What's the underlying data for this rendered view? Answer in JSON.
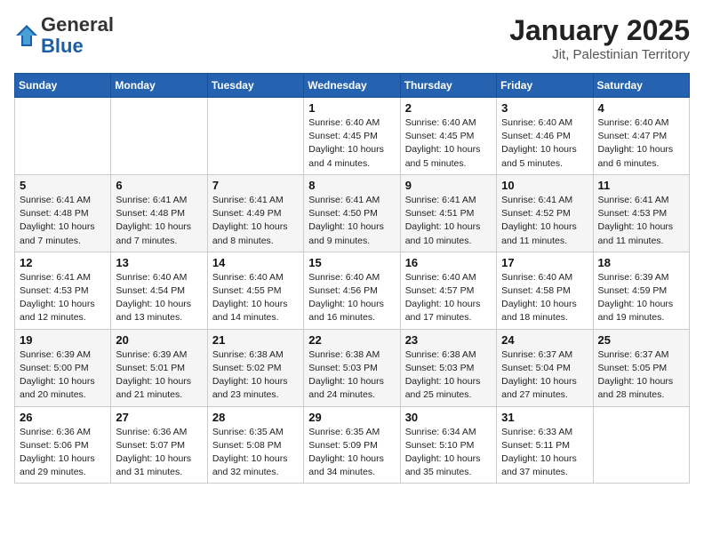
{
  "header": {
    "logo_line1": "General",
    "logo_line2": "Blue",
    "title": "January 2025",
    "subtitle": "Jit, Palestinian Territory"
  },
  "weekdays": [
    "Sunday",
    "Monday",
    "Tuesday",
    "Wednesday",
    "Thursday",
    "Friday",
    "Saturday"
  ],
  "weeks": [
    [
      {
        "day": "",
        "info": ""
      },
      {
        "day": "",
        "info": ""
      },
      {
        "day": "",
        "info": ""
      },
      {
        "day": "1",
        "info": "Sunrise: 6:40 AM\nSunset: 4:45 PM\nDaylight: 10 hours\nand 4 minutes."
      },
      {
        "day": "2",
        "info": "Sunrise: 6:40 AM\nSunset: 4:45 PM\nDaylight: 10 hours\nand 5 minutes."
      },
      {
        "day": "3",
        "info": "Sunrise: 6:40 AM\nSunset: 4:46 PM\nDaylight: 10 hours\nand 5 minutes."
      },
      {
        "day": "4",
        "info": "Sunrise: 6:40 AM\nSunset: 4:47 PM\nDaylight: 10 hours\nand 6 minutes."
      }
    ],
    [
      {
        "day": "5",
        "info": "Sunrise: 6:41 AM\nSunset: 4:48 PM\nDaylight: 10 hours\nand 7 minutes."
      },
      {
        "day": "6",
        "info": "Sunrise: 6:41 AM\nSunset: 4:48 PM\nDaylight: 10 hours\nand 7 minutes."
      },
      {
        "day": "7",
        "info": "Sunrise: 6:41 AM\nSunset: 4:49 PM\nDaylight: 10 hours\nand 8 minutes."
      },
      {
        "day": "8",
        "info": "Sunrise: 6:41 AM\nSunset: 4:50 PM\nDaylight: 10 hours\nand 9 minutes."
      },
      {
        "day": "9",
        "info": "Sunrise: 6:41 AM\nSunset: 4:51 PM\nDaylight: 10 hours\nand 10 minutes."
      },
      {
        "day": "10",
        "info": "Sunrise: 6:41 AM\nSunset: 4:52 PM\nDaylight: 10 hours\nand 11 minutes."
      },
      {
        "day": "11",
        "info": "Sunrise: 6:41 AM\nSunset: 4:53 PM\nDaylight: 10 hours\nand 11 minutes."
      }
    ],
    [
      {
        "day": "12",
        "info": "Sunrise: 6:41 AM\nSunset: 4:53 PM\nDaylight: 10 hours\nand 12 minutes."
      },
      {
        "day": "13",
        "info": "Sunrise: 6:40 AM\nSunset: 4:54 PM\nDaylight: 10 hours\nand 13 minutes."
      },
      {
        "day": "14",
        "info": "Sunrise: 6:40 AM\nSunset: 4:55 PM\nDaylight: 10 hours\nand 14 minutes."
      },
      {
        "day": "15",
        "info": "Sunrise: 6:40 AM\nSunset: 4:56 PM\nDaylight: 10 hours\nand 16 minutes."
      },
      {
        "day": "16",
        "info": "Sunrise: 6:40 AM\nSunset: 4:57 PM\nDaylight: 10 hours\nand 17 minutes."
      },
      {
        "day": "17",
        "info": "Sunrise: 6:40 AM\nSunset: 4:58 PM\nDaylight: 10 hours\nand 18 minutes."
      },
      {
        "day": "18",
        "info": "Sunrise: 6:39 AM\nSunset: 4:59 PM\nDaylight: 10 hours\nand 19 minutes."
      }
    ],
    [
      {
        "day": "19",
        "info": "Sunrise: 6:39 AM\nSunset: 5:00 PM\nDaylight: 10 hours\nand 20 minutes."
      },
      {
        "day": "20",
        "info": "Sunrise: 6:39 AM\nSunset: 5:01 PM\nDaylight: 10 hours\nand 21 minutes."
      },
      {
        "day": "21",
        "info": "Sunrise: 6:38 AM\nSunset: 5:02 PM\nDaylight: 10 hours\nand 23 minutes."
      },
      {
        "day": "22",
        "info": "Sunrise: 6:38 AM\nSunset: 5:03 PM\nDaylight: 10 hours\nand 24 minutes."
      },
      {
        "day": "23",
        "info": "Sunrise: 6:38 AM\nSunset: 5:03 PM\nDaylight: 10 hours\nand 25 minutes."
      },
      {
        "day": "24",
        "info": "Sunrise: 6:37 AM\nSunset: 5:04 PM\nDaylight: 10 hours\nand 27 minutes."
      },
      {
        "day": "25",
        "info": "Sunrise: 6:37 AM\nSunset: 5:05 PM\nDaylight: 10 hours\nand 28 minutes."
      }
    ],
    [
      {
        "day": "26",
        "info": "Sunrise: 6:36 AM\nSunset: 5:06 PM\nDaylight: 10 hours\nand 29 minutes."
      },
      {
        "day": "27",
        "info": "Sunrise: 6:36 AM\nSunset: 5:07 PM\nDaylight: 10 hours\nand 31 minutes."
      },
      {
        "day": "28",
        "info": "Sunrise: 6:35 AM\nSunset: 5:08 PM\nDaylight: 10 hours\nand 32 minutes."
      },
      {
        "day": "29",
        "info": "Sunrise: 6:35 AM\nSunset: 5:09 PM\nDaylight: 10 hours\nand 34 minutes."
      },
      {
        "day": "30",
        "info": "Sunrise: 6:34 AM\nSunset: 5:10 PM\nDaylight: 10 hours\nand 35 minutes."
      },
      {
        "day": "31",
        "info": "Sunrise: 6:33 AM\nSunset: 5:11 PM\nDaylight: 10 hours\nand 37 minutes."
      },
      {
        "day": "",
        "info": ""
      }
    ]
  ]
}
